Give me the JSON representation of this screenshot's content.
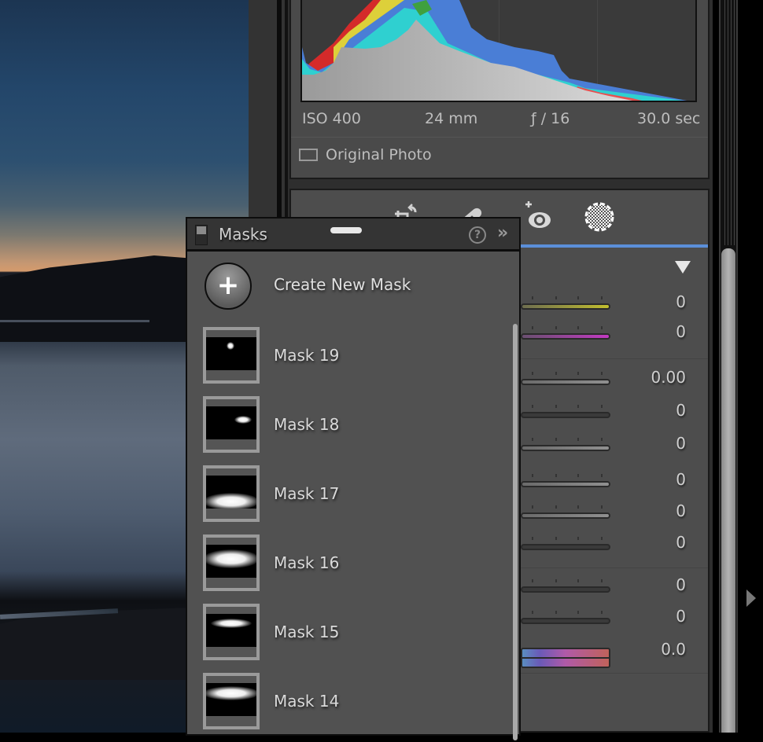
{
  "photo": {
    "description": "coastal sunset long exposure"
  },
  "histogram": {
    "exif": {
      "iso": "ISO 400",
      "focal_length": "24 mm",
      "aperture": "ƒ / 16",
      "shutter": "30.0 sec"
    },
    "original_photo_label": "Original Photo",
    "original_photo_checked": false
  },
  "toolstrip": {
    "tools": [
      {
        "name": "crop",
        "icon": "crop-icon",
        "active": false
      },
      {
        "name": "heal",
        "icon": "bandage-icon",
        "active": false
      },
      {
        "name": "red-eye",
        "icon": "eye-plus-icon",
        "active": false
      },
      {
        "name": "masking",
        "icon": "mask-circle-icon",
        "active": true
      }
    ],
    "accent_color": "#5b8fd9"
  },
  "sliders": [
    {
      "value": "0",
      "track": "yellow"
    },
    {
      "value": "0",
      "track": "magenta"
    },
    {
      "value": "0.00",
      "track": "gray"
    },
    {
      "value": "0",
      "track": "dark"
    },
    {
      "value": "0",
      "track": "gray"
    },
    {
      "value": "0",
      "track": "gray"
    },
    {
      "value": "0",
      "track": "gray"
    },
    {
      "value": "0",
      "track": "dark"
    },
    {
      "value": "0",
      "track": "dark"
    },
    {
      "value": "0",
      "track": "dark"
    },
    {
      "value": "0.0",
      "track": "hue"
    }
  ],
  "masks_panel": {
    "title": "Masks",
    "help_icon": "?",
    "expand_icon": "»",
    "create_label": "Create New Mask",
    "create_icon": "+",
    "items": [
      {
        "label": "Mask 19"
      },
      {
        "label": "Mask 18"
      },
      {
        "label": "Mask 17"
      },
      {
        "label": "Mask 16"
      },
      {
        "label": "Mask 15"
      },
      {
        "label": "Mask 14"
      }
    ]
  }
}
